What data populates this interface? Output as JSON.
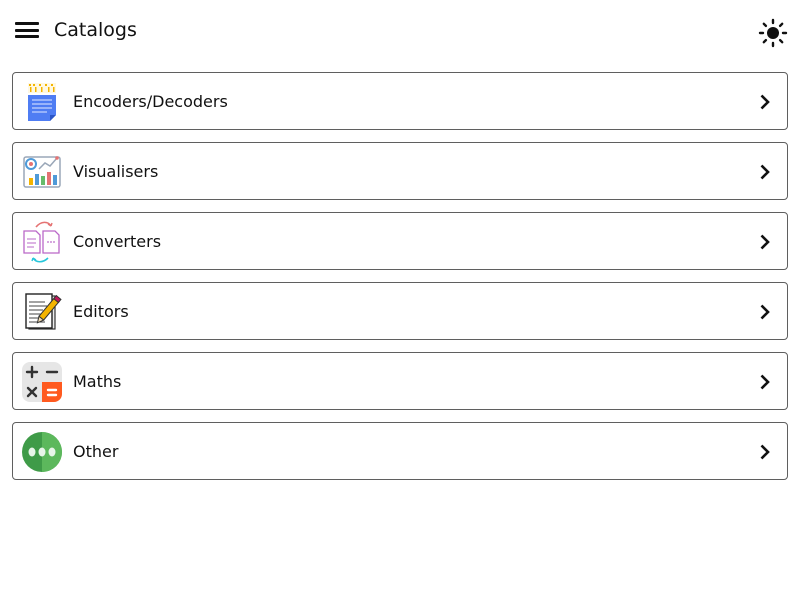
{
  "header": {
    "title": "Catalogs",
    "menu_icon": "hamburger-menu-icon",
    "theme_icon": "sun-icon"
  },
  "catalogs": [
    {
      "label": "Encoders/Decoders",
      "icon": "encoder-decoder-icon"
    },
    {
      "label": "Visualisers",
      "icon": "visualiser-chart-icon"
    },
    {
      "label": "Converters",
      "icon": "converter-documents-icon"
    },
    {
      "label": "Editors",
      "icon": "editor-notepad-icon"
    },
    {
      "label": "Maths",
      "icon": "calculator-icon"
    },
    {
      "label": "Other",
      "icon": "more-dots-icon"
    }
  ],
  "colors": {
    "border": "#5f5f5f",
    "text": "#111111",
    "background": "#ffffff"
  }
}
